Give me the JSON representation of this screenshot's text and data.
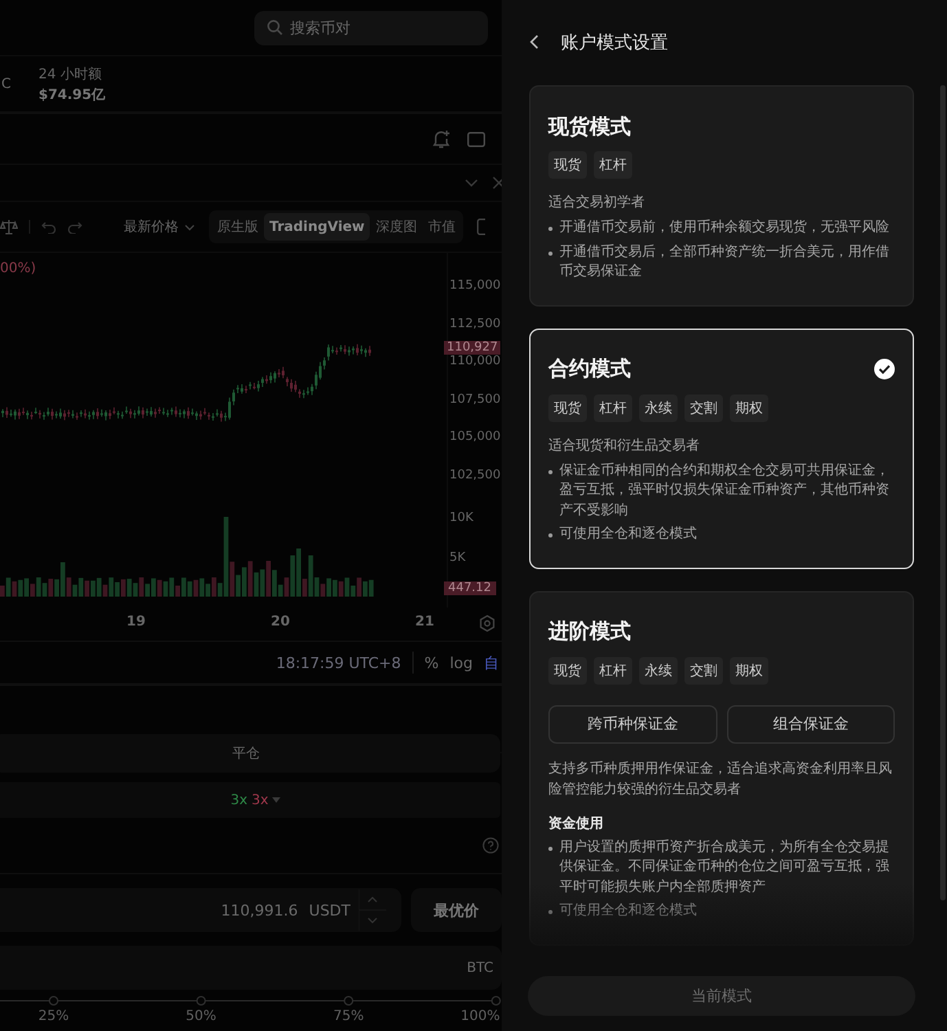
{
  "left": {
    "search": {
      "placeholder": "搜索币对"
    },
    "ticker": {
      "symbol_tail": "C",
      "stat_label": "24 小时额",
      "stat_value": "$74.95亿"
    },
    "chart_toolbar": {
      "price_type": "最新价格",
      "views": [
        {
          "label": "原生版",
          "selected": false
        },
        {
          "label": "TradingView",
          "selected": true
        },
        {
          "label": "深度图",
          "selected": false
        },
        {
          "label": "市值",
          "selected": false
        }
      ]
    },
    "chart": {
      "change_text": "00%)",
      "price_ticks": [
        "115,000",
        "112,500",
        "110,000",
        "107,500",
        "105,000",
        "102,500"
      ],
      "last_price": "110,927",
      "volume_ticks": [
        "10K",
        "5K"
      ],
      "last_volume": "447.12",
      "dates": [
        "19",
        "20",
        "21"
      ]
    },
    "chart_footer": {
      "time": "18:17:59 UTC+8",
      "percent": "%",
      "log": "log",
      "auto": "自"
    },
    "close_button": "平仓",
    "leverage": {
      "long": "3x",
      "short": "3x"
    },
    "price_field": {
      "value": "110,991.6",
      "unit": "USDT"
    },
    "best_price_button": "最优价",
    "amount_field": {
      "unit": "BTC"
    },
    "slider_marks": [
      "25%",
      "50%",
      "75%",
      "100%"
    ]
  },
  "drawer": {
    "title": "账户模式设置",
    "modes": [
      {
        "title": "现货模式",
        "selected": false,
        "tags": [
          "现货",
          "杠杆"
        ],
        "description": "适合交易初学者",
        "bullets": [
          "开通借币交易前，使用币种余额交易现货，无强平风险",
          "开通借币交易后，全部币种资产统一折合美元，用作借币交易保证金"
        ]
      },
      {
        "title": "合约模式",
        "selected": true,
        "tags": [
          "现货",
          "杠杆",
          "永续",
          "交割",
          "期权"
        ],
        "description": "适合现货和衍生品交易者",
        "bullets": [
          "保证金币种相同的合约和期权全仓交易可共用保证金，盈亏互抵，强平时仅损失保证金币种资产，其他币种资产不受影响",
          "可使用全仓和逐仓模式"
        ]
      },
      {
        "title": "进阶模式",
        "selected": false,
        "tags": [
          "现货",
          "杠杆",
          "永续",
          "交割",
          "期权"
        ],
        "options": [
          "跨币种保证金",
          "组合保证金"
        ],
        "description": "支持多币种质押用作保证金，适合追求高资金利用率且风险管控能力较强的衍生品交易者",
        "section": "资金使用",
        "bullets": [
          "用户设置的质押币资产折合成美元，为所有全仓交易提供保证金。不同保证金币种的仓位之间可盈亏互抵，强平时可能损失账户内全部质押资产",
          "可使用全仓和逐仓模式"
        ]
      }
    ],
    "footer_button": "当前模式"
  }
}
